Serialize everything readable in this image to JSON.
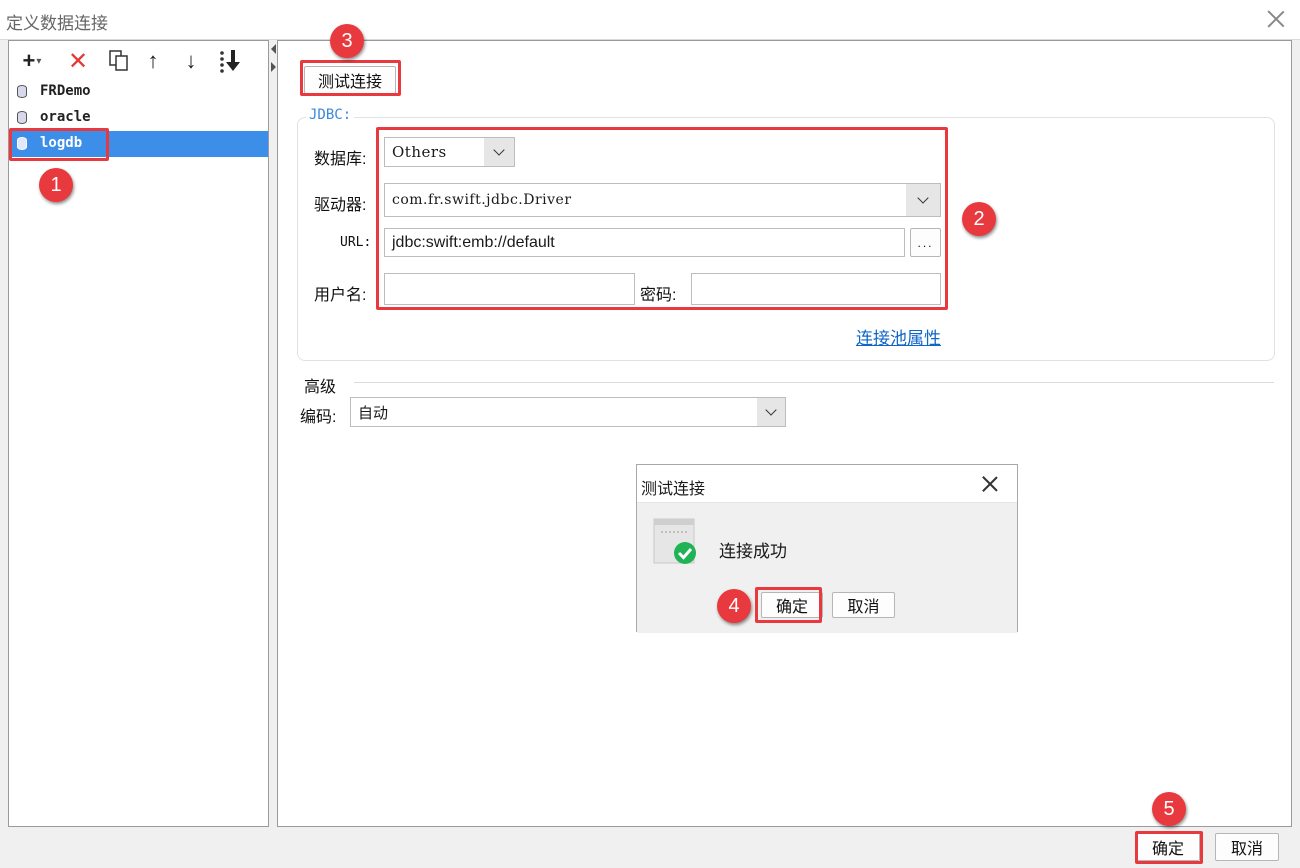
{
  "window": {
    "title": "定义数据连接"
  },
  "toolbar": {
    "add": "+",
    "add_caret": "▾",
    "delete": "✕",
    "up": "↑",
    "down": "↓"
  },
  "connections": [
    {
      "label": "FRDemo",
      "selected": false
    },
    {
      "label": "oracle",
      "selected": false
    },
    {
      "label": "logdb",
      "selected": true
    }
  ],
  "test_button": "测试连接",
  "jdbc": {
    "group_label": "JDBC:",
    "database_label": "数据库:",
    "database_value": "Others",
    "driver_label": "驱动器:",
    "driver_value": "com.fr.swift.jdbc.Driver",
    "url_label": "URL:",
    "url_value": "jdbc:swift:emb://default",
    "url_browse": "...",
    "username_label": "用户名:",
    "username_value": "",
    "password_label": "密码:",
    "password_value": "",
    "pool_link": "连接池属性"
  },
  "advanced": {
    "section_label": "高级",
    "encoding_label": "编码:",
    "encoding_value": "自动"
  },
  "dialog": {
    "title": "测试连接",
    "message": "连接成功",
    "ok": "确定",
    "cancel": "取消"
  },
  "footer": {
    "ok": "确定",
    "cancel": "取消"
  },
  "badges": [
    "1",
    "2",
    "3",
    "4",
    "5"
  ],
  "colors": {
    "selection": "#3d8ee9",
    "annotation_red": "#e8393f",
    "link": "#1066c8",
    "success_green": "#1fb356"
  }
}
